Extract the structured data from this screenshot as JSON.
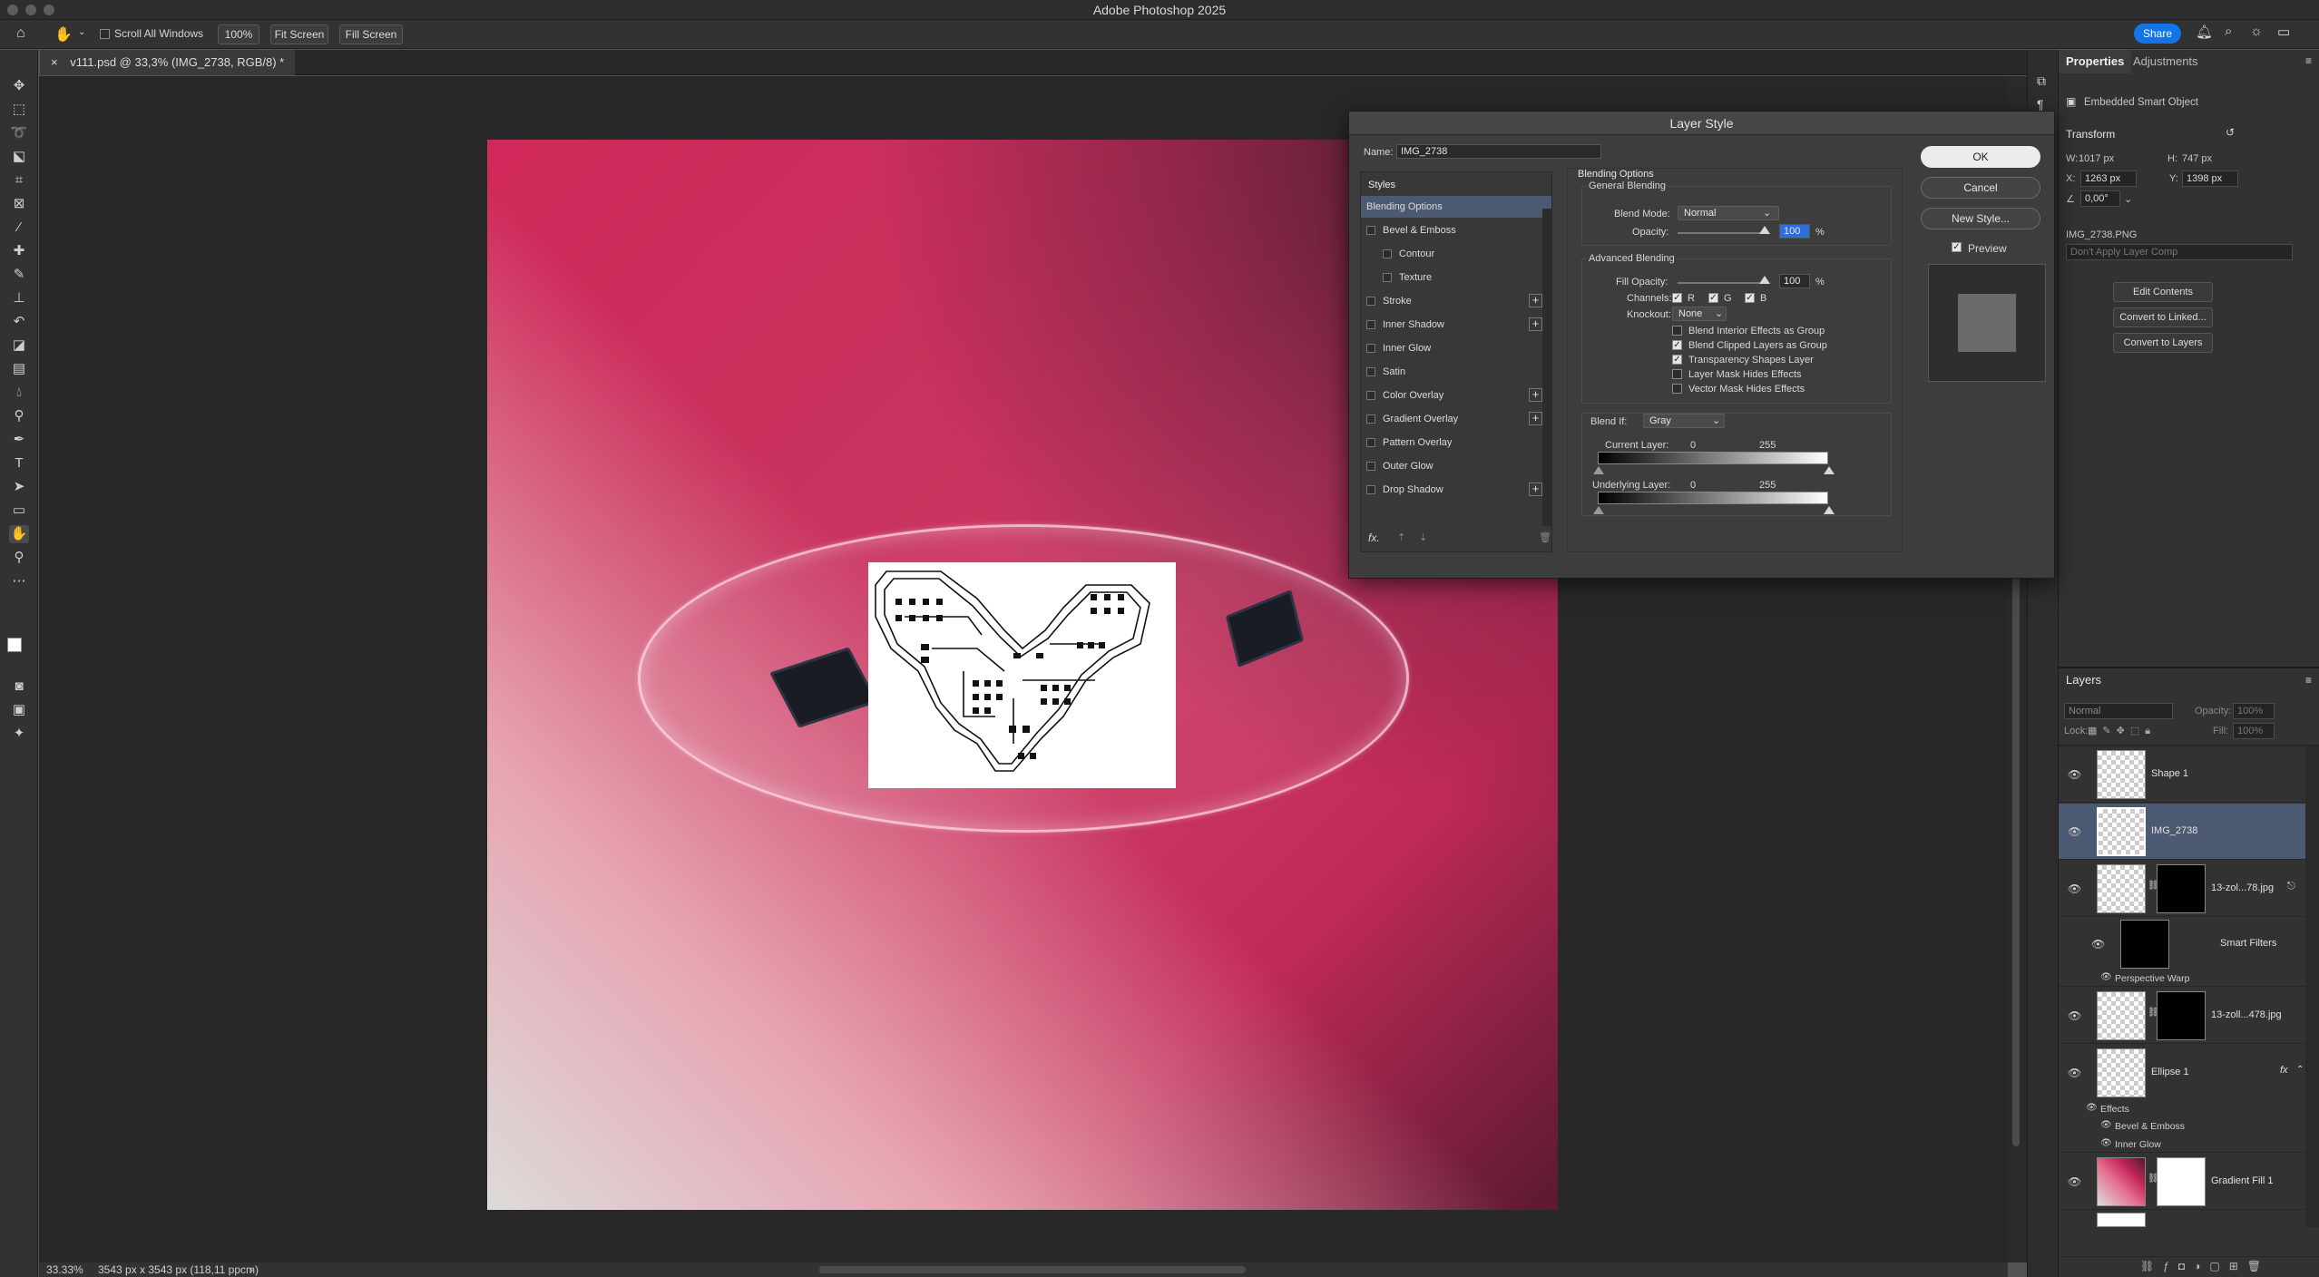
{
  "app": {
    "title": "Adobe Photoshop 2025"
  },
  "options_bar": {
    "scroll_all_windows": "Scroll All Windows",
    "zoom": "100%",
    "fit_screen": "Fit Screen",
    "fill_screen": "Fill Screen",
    "share": "Share"
  },
  "document_tab": {
    "label": "v111.psd @ 33,3% (IMG_2738, RGB/8) *",
    "close": "×"
  },
  "status_bar": {
    "zoom": "33.33%",
    "info": "3543 px x 3543 px (118,11 ppcm)"
  },
  "properties": {
    "tabs": [
      "Properties",
      "Adjustments"
    ],
    "type": "Embedded Smart Object",
    "transform_label": "Transform",
    "w_label": "W:",
    "w_value": "1017 px",
    "h_label": "H:",
    "h_value": "747 px",
    "x_label": "X:",
    "x_value": "1263 px",
    "y_label": "Y:",
    "y_value": "1398 px",
    "angle_value": "0,00°",
    "filename": "IMG_2738.PNG",
    "layer_comp": "Don't Apply Layer Comp",
    "buttons": [
      "Edit Contents",
      "Convert to Linked...",
      "Convert to Layers"
    ]
  },
  "layers": {
    "title": "Layers",
    "blend_mode": "Normal",
    "opacity_label": "Opacity:",
    "opacity_value": "100%",
    "lock_label": "Lock:",
    "fill_label": "Fill:",
    "fill_value": "100%",
    "items": [
      {
        "name": "Shape 1"
      },
      {
        "name": "IMG_2738"
      },
      {
        "name": "13-zol...78.jpg"
      },
      {
        "name": "Smart Filters"
      },
      {
        "name": "Perspective Warp"
      },
      {
        "name": "13-zoll...478.jpg"
      },
      {
        "name": "Ellipse 1",
        "fx": "fx"
      },
      {
        "name": "Effects"
      },
      {
        "name": "Bevel & Emboss"
      },
      {
        "name": "Inner Glow"
      },
      {
        "name": "Gradient Fill 1"
      }
    ]
  },
  "dialog": {
    "title": "Layer Style",
    "name_label": "Name:",
    "name_value": "IMG_2738",
    "styles_header": "Styles",
    "styles": [
      {
        "label": "Blending Options",
        "checkbox": false,
        "selected": true
      },
      {
        "label": "Bevel & Emboss",
        "checkbox": true
      },
      {
        "label": "Contour",
        "checkbox": true,
        "indent": true
      },
      {
        "label": "Texture",
        "checkbox": true,
        "indent": true
      },
      {
        "label": "Stroke",
        "checkbox": true,
        "plus": true
      },
      {
        "label": "Inner Shadow",
        "checkbox": true,
        "plus": true
      },
      {
        "label": "Inner Glow",
        "checkbox": true
      },
      {
        "label": "Satin",
        "checkbox": true
      },
      {
        "label": "Color Overlay",
        "checkbox": true,
        "plus": true
      },
      {
        "label": "Gradient Overlay",
        "checkbox": true,
        "plus": true
      },
      {
        "label": "Pattern Overlay",
        "checkbox": true
      },
      {
        "label": "Outer Glow",
        "checkbox": true
      },
      {
        "label": "Drop Shadow",
        "checkbox": true,
        "plus": true
      }
    ],
    "fx_label": "fx.",
    "blending_options": "Blending Options",
    "general_blending": "General Blending",
    "blend_mode_label": "Blend Mode:",
    "blend_mode_value": "Normal",
    "opacity_label": "Opacity:",
    "opacity_value": "100",
    "percent": "%",
    "opacity_fraction": 1.0,
    "advanced_blending": "Advanced Blending",
    "fill_opacity_label": "Fill Opacity:",
    "fill_opacity_value": "100",
    "fill_opacity_fraction": 1.0,
    "channels_label": "Channels:",
    "channels": [
      "R",
      "G",
      "B"
    ],
    "knockout_label": "Knockout:",
    "knockout_value": "None",
    "options": [
      {
        "label": "Blend Interior Effects as Group",
        "checked": false
      },
      {
        "label": "Blend Clipped Layers as Group",
        "checked": true
      },
      {
        "label": "Transparency Shapes Layer",
        "checked": true
      },
      {
        "label": "Layer Mask Hides Effects",
        "checked": false
      },
      {
        "label": "Vector Mask Hides Effects",
        "checked": false
      }
    ],
    "blend_if_label": "Blend If:",
    "blend_if_value": "Gray",
    "current_layer_label": "Current Layer:",
    "underlying_layer_label": "Underlying Layer:",
    "range_low": "0",
    "range_high": "255",
    "ok": "OK",
    "cancel": "Cancel",
    "new_style": "New Style...",
    "preview": "Preview"
  }
}
